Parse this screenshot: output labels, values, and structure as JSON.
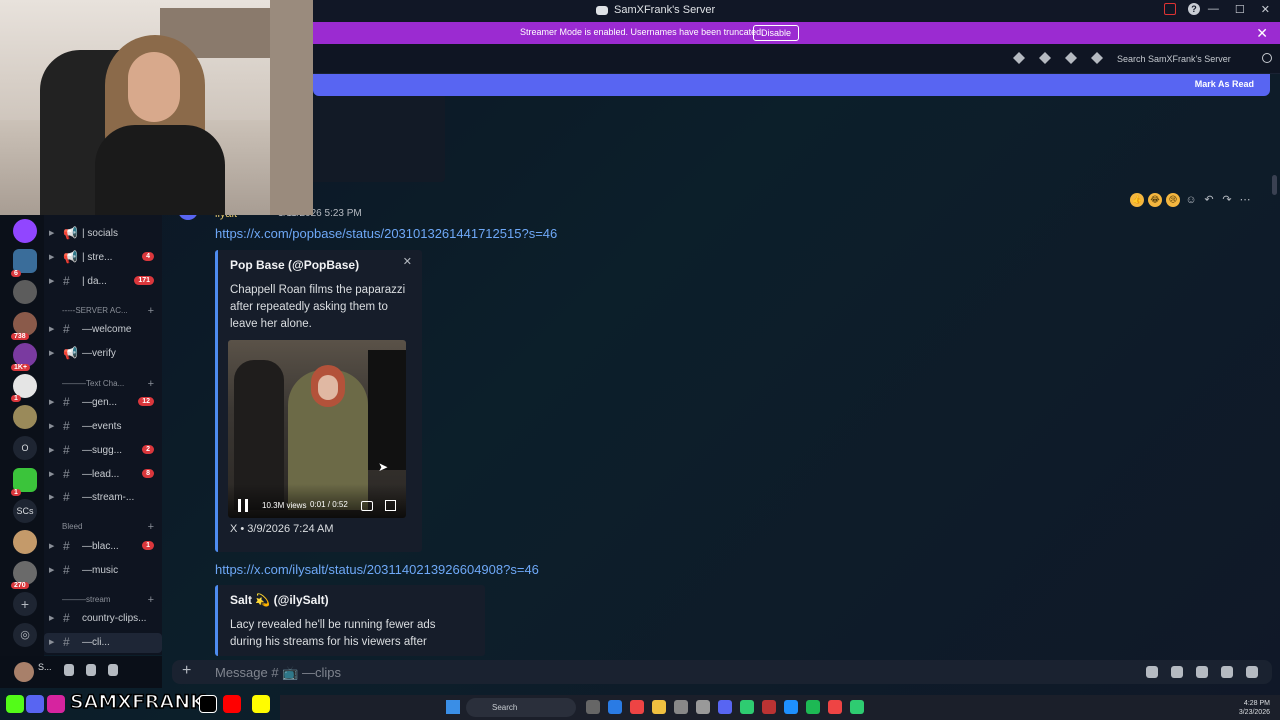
{
  "window": {
    "title": "SamXFrank's Server"
  },
  "banner": {
    "message": "Streamer Mode is enabled. Usernames have been truncated.",
    "button": "Disable",
    "close": "✕"
  },
  "header": {
    "search_placeholder": "Search SamXFrank's Server"
  },
  "newbar": {
    "mark_label": "Mark As Read"
  },
  "servers": [
    {
      "badge": ""
    },
    {
      "badge": "6"
    },
    {
      "badge": ""
    },
    {
      "badge": "738"
    },
    {
      "badge": "1K+"
    },
    {
      "badge": "1"
    },
    {
      "badge": ""
    },
    {
      "text": "O"
    },
    {
      "badge": "1"
    },
    {
      "text": "SCs"
    },
    {
      "badge": ""
    },
    {
      "badge": "270"
    }
  ],
  "channels": [
    {
      "name": "| socials",
      "count": ""
    },
    {
      "name": "| stre...",
      "count": "4"
    },
    {
      "name": "| da...",
      "count": "171"
    },
    {
      "category": "-----SERVER AC..."
    },
    {
      "name": "—welcome",
      "count": ""
    },
    {
      "name": "—verify",
      "count": ""
    },
    {
      "category": "———Text Cha..."
    },
    {
      "name": "—gen...",
      "count": "12"
    },
    {
      "name": "—events",
      "count": ""
    },
    {
      "name": "—sugg...",
      "count": "2"
    },
    {
      "name": "—lead...",
      "count": "8"
    },
    {
      "name": "—stream-...",
      "count": ""
    },
    {
      "category": "Bleed"
    },
    {
      "name": "—blac...",
      "count": "1"
    },
    {
      "name": "—music",
      "count": ""
    },
    {
      "category": "———stream"
    },
    {
      "name": "country-clips...",
      "count": ""
    },
    {
      "name": "—cli...",
      "count": ""
    }
  ],
  "user": {
    "name": "S..."
  },
  "message": {
    "author": "ilyalt",
    "timestamp": "3/11/2026 5:23 PM",
    "link1": "https://x.com/popbase/status/2031013261441712515?s=46",
    "embed1": {
      "author": "Pop Base (@PopBase)",
      "description": "Chappell Roan films the paparazzi after repeatedly asking them to leave her alone.",
      "views": "10.3M views",
      "time": "0:01 / 0:52",
      "footer": "X • 3/9/2026 7:24 AM"
    },
    "link2": "https://x.com/ilysalt/status/2031140213926604908?s=46",
    "embed2": {
      "author": "Salt 💫 (@ilySalt)",
      "description": "Lacy revealed he'll be running fewer ads during his streams for his viewers after"
    }
  },
  "hover_actions": [
    "👍",
    "😂",
    "😢"
  ],
  "input": {
    "placeholder": "Message # 📺 —clips"
  },
  "overlay": {
    "brand": "SAMXFRANK"
  },
  "taskbar": {
    "search": "Search",
    "time": "4:28 PM",
    "date": "3/23/2026"
  }
}
